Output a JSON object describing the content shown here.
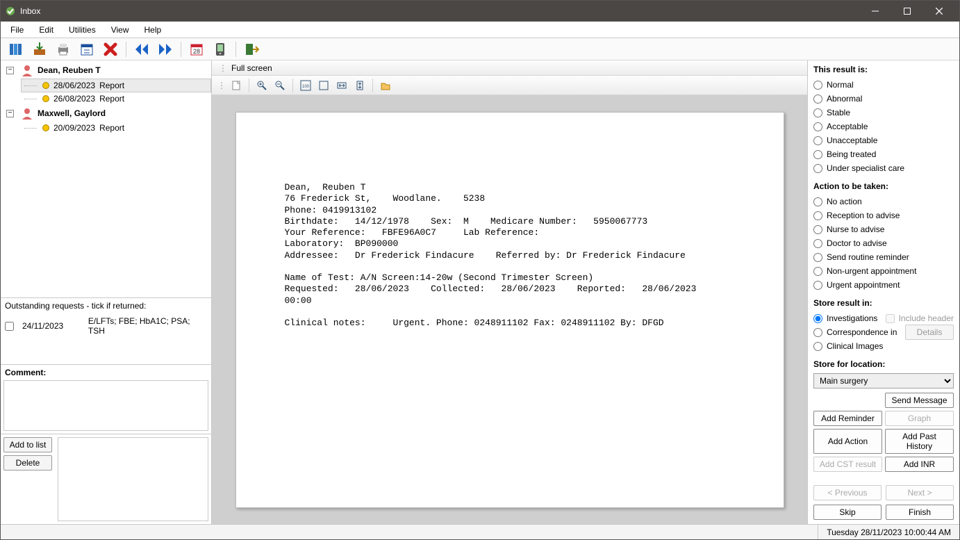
{
  "titlebar": {
    "title": "Inbox"
  },
  "menu": {
    "items": [
      "File",
      "Edit",
      "Utilities",
      "View",
      "Help"
    ]
  },
  "tree": {
    "patients": [
      {
        "name": "Dean, Reuben T",
        "expanded": true,
        "reports": [
          {
            "date": "28/06/2023",
            "type": "Report",
            "selected": true
          },
          {
            "date": "26/08/2023",
            "type": "Report",
            "selected": false
          }
        ]
      },
      {
        "name": "Maxwell, Gaylord",
        "expanded": true,
        "reports": [
          {
            "date": "20/09/2023",
            "type": "Report",
            "selected": false
          }
        ]
      }
    ]
  },
  "outstanding": {
    "header": "Outstanding requests - tick if returned:",
    "items": [
      {
        "date": "24/11/2023",
        "desc": "E/LFTs; FBE; HbA1C; PSA; TSH"
      }
    ]
  },
  "comment": {
    "label": "Comment:"
  },
  "left_buttons": {
    "add": "Add to list",
    "delete": "Delete"
  },
  "viewer": {
    "fullscreen_label": "Full screen",
    "report_text": "Dean,  Reuben T\n76 Frederick St,    Woodlane.    5238\nPhone: 0419913102\nBirthdate:   14/12/1978    Sex:  M    Medicare Number:   5950067773\nYour Reference:   FBFE96A0C7     Lab Reference:\nLaboratory:  BP090000\nAddressee:   Dr Frederick Findacure    Referred by: Dr Frederick Findacure\n\nName of Test: A/N Screen:14-20w (Second Trimester Screen)\nRequested:   28/06/2023    Collected:   28/06/2023    Reported:   28/06/2023\n00:00\n\nClinical notes:     Urgent. Phone: 0248911102 Fax: 0248911102 By: DFGD"
  },
  "right": {
    "result_hdr": "This result is:",
    "result_options": [
      "Normal",
      "Abnormal",
      "Stable",
      "Acceptable",
      "Unacceptable",
      "Being treated",
      "Under specialist care"
    ],
    "action_hdr": "Action to be taken:",
    "action_options": [
      "No action",
      "Reception to advise",
      "Nurse to advise",
      "Doctor to advise",
      "Send routine reminder",
      "Non-urgent appointment",
      "Urgent appointment"
    ],
    "store_hdr": "Store result in:",
    "store_options": [
      "Investigations",
      "Correspondence in",
      "Clinical Images"
    ],
    "store_selected": "Investigations",
    "include_header": "Include header",
    "details_btn": "Details",
    "location_hdr": "Store for location:",
    "location_value": "Main surgery",
    "buttons": {
      "send_message": "Send Message",
      "add_reminder": "Add Reminder",
      "graph": "Graph",
      "add_action": "Add Action",
      "add_past": "Add Past History",
      "add_cst": "Add CST result",
      "add_inr": "Add INR",
      "prev": "< Previous",
      "next": "Next >",
      "skip": "Skip",
      "finish": "Finish"
    }
  },
  "status": {
    "datetime": "Tuesday 28/11/2023 10:00:44 AM"
  }
}
